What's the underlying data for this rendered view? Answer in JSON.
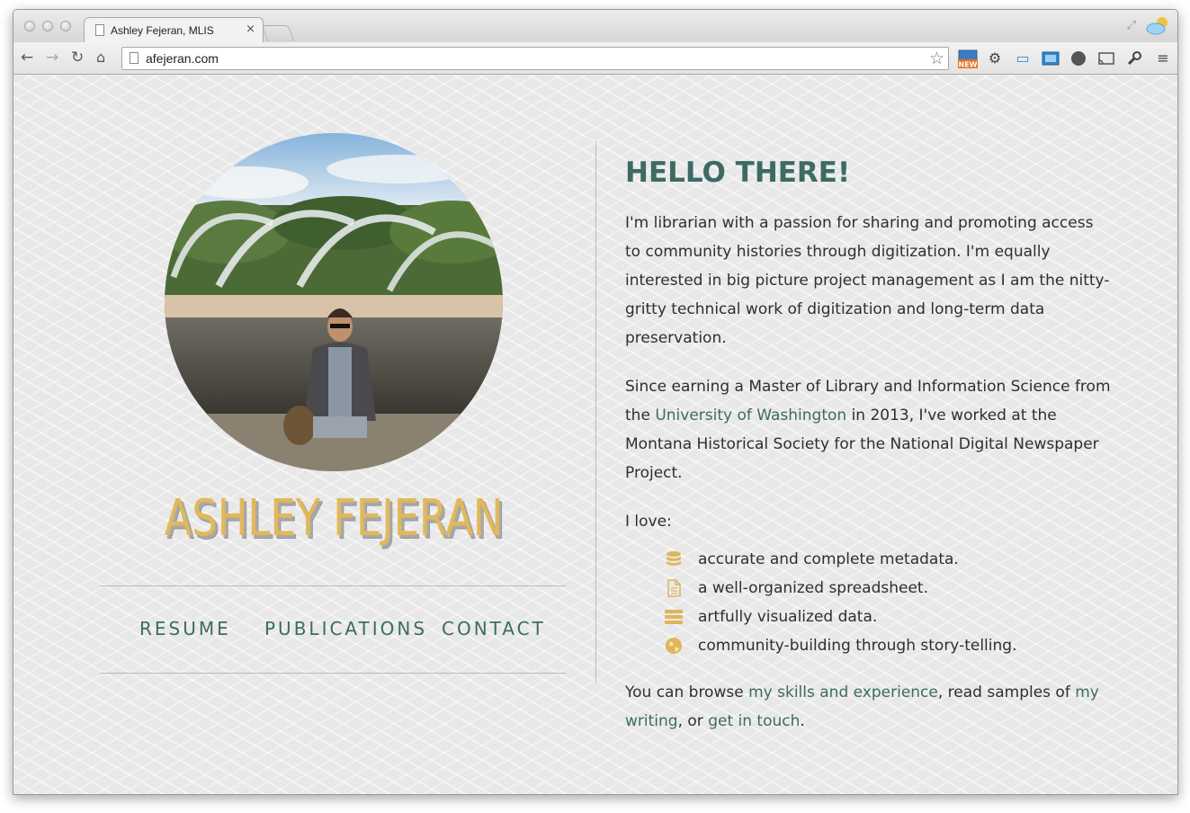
{
  "browser": {
    "tab_title": "Ashley Fejeran, MLIS",
    "tab_close": "×",
    "url": "afejeran.com",
    "extension_badge": "NEW",
    "icons": [
      "back-icon",
      "forward-icon",
      "reload-icon",
      "home-icon",
      "star-icon",
      "extension-new-icon",
      "gear-icon",
      "folder-icon",
      "screenshot-icon",
      "compass-icon",
      "cast-icon",
      "wrench-icon",
      "menu-icon",
      "fullscreen-icon",
      "weather-icon"
    ]
  },
  "profile": {
    "name": "ASHLEY FEJERAN"
  },
  "nav": {
    "resume": "RESUME",
    "publications": "PUBLICATIONS",
    "contact": "CONTACT"
  },
  "intro": {
    "heading": "HELLO THERE!",
    "para1": "I'm librarian with a passion for sharing and promoting access to community histories through digitization. I'm equally interested in big picture project management as I am the nitty-gritty technical work of digitization and long-term data preservation.",
    "para2_before": "Since earning a Master of Library and Information Science from the ",
    "para2_link": "University of Washington",
    "para2_after": " in 2013, I've worked at the Montana Historical Society for the National Digital Newspaper Project.",
    "love_label": "I love:",
    "loves": [
      {
        "icon": "database-icon",
        "text": "accurate and complete metadata."
      },
      {
        "icon": "document-icon",
        "text": "a well-organized spreadsheet."
      },
      {
        "icon": "server-icon",
        "text": "artfully visualized data."
      },
      {
        "icon": "globe-icon",
        "text": "community-building through story-telling."
      }
    ],
    "browse_1": "You can browse ",
    "browse_link1": "my skills and experience",
    "browse_2": ", read samples of ",
    "browse_link2": "my writing",
    "browse_3": ", or ",
    "browse_link3": "get in touch",
    "browse_4": "."
  },
  "colors": {
    "accent_teal": "#3c6b63",
    "name_gold": "#e2b85a",
    "icon_gold": "#e0b55a"
  }
}
